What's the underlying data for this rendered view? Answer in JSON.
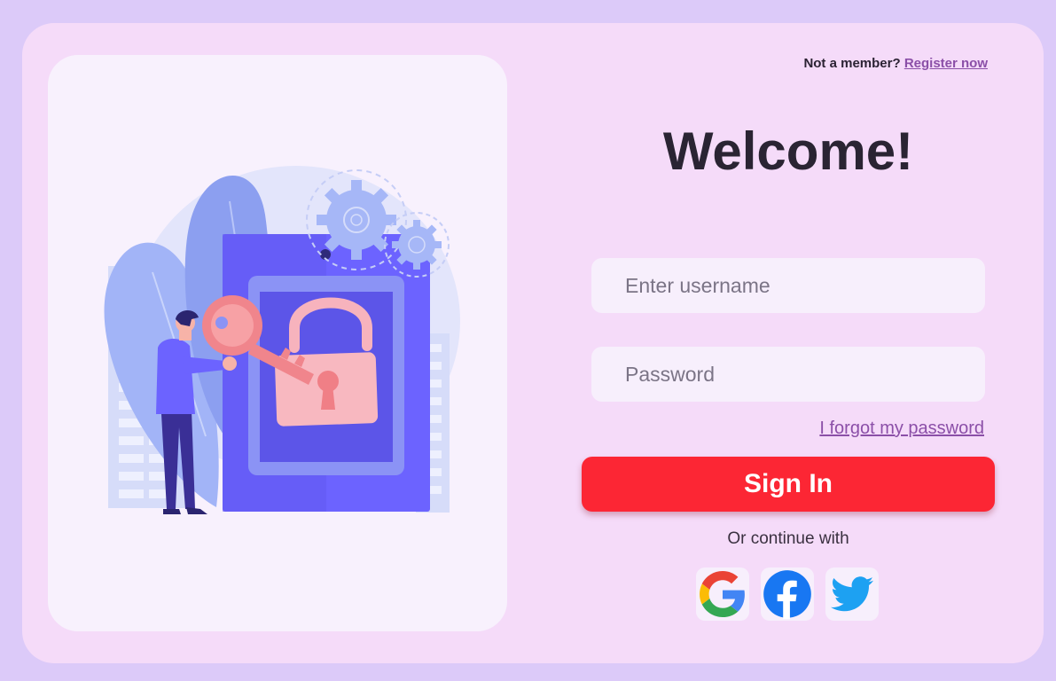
{
  "header": {
    "prompt": "Not a member?",
    "register_link": "Register now"
  },
  "welcome_title": "Welcome!",
  "form": {
    "username_placeholder": "Enter username",
    "password_placeholder": "Password",
    "forgot_link": "I forgot my password",
    "signin_label": "Sign In"
  },
  "continue_text": "Or continue with",
  "socials": [
    {
      "icon": "google-icon"
    },
    {
      "icon": "facebook-icon"
    },
    {
      "icon": "twitter-icon"
    }
  ],
  "colors": {
    "background": "#dccaf9",
    "card": "#f5dbf9",
    "accent_button": "#fc2634",
    "link": "#8b4fa8",
    "illustration_primary": "#6c63ff"
  }
}
